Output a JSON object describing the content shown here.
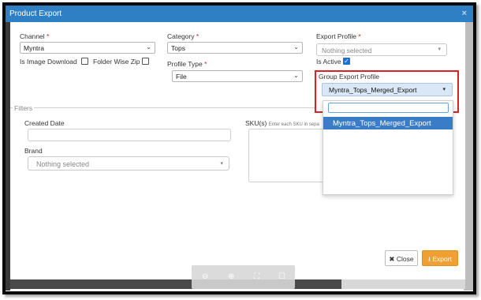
{
  "window": {
    "title": "Product Export",
    "close_glyph": "×"
  },
  "channel": {
    "label": "Channel",
    "required": "*",
    "value": "Myntra",
    "caret": "⌄"
  },
  "category": {
    "label": "Category",
    "required": "*",
    "value": "Tops",
    "caret": "⌄"
  },
  "export_profile": {
    "label": "Export Profile",
    "required": "*",
    "value": "Nothing selected",
    "caret": "▾"
  },
  "is_image_download": {
    "label": "Is Image Download"
  },
  "folder_wise_zip": {
    "label": "Folder Wise Zip"
  },
  "profile_type": {
    "label": "Profile Type",
    "required": "*",
    "value": "File",
    "caret": "⌄"
  },
  "is_active": {
    "label": "Is Active",
    "checked": true,
    "check_glyph": "✓"
  },
  "group_export_profile": {
    "label": "Group Export Profile",
    "value": "Myntra_Tops_Merged_Export",
    "caret": "▾",
    "dropdown_options": [
      "Myntra_Tops_Merged_Export"
    ]
  },
  "filters": {
    "legend": "Filters"
  },
  "created_date": {
    "label": "Created Date"
  },
  "sku": {
    "label": "SKU(s)",
    "hint": "Enter each SKU in sepa"
  },
  "brand": {
    "label": "Brand",
    "value": "Nothing selected",
    "caret": "▾"
  },
  "buttons": {
    "close": "✖ Close",
    "export": "⭳ Export"
  },
  "zoom_toolbar": {
    "zoom_out": "⊖",
    "zoom_in": "⊕",
    "fit": "⛶",
    "fullscreen": "☐"
  },
  "colors": {
    "title_bar": "#2f7fc4",
    "highlight_box": "#e02020",
    "selected_option": "#3a7cc6",
    "export_button": "#f0a030"
  }
}
